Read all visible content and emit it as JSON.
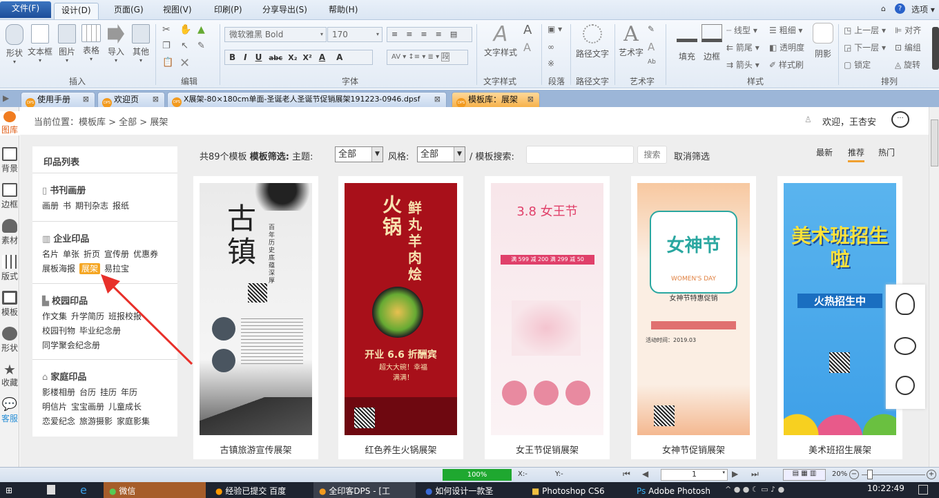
{
  "menu": {
    "items": [
      "文件(F)",
      "设计(D)",
      "页面(G)",
      "视图(V)",
      "印刷(P)",
      "分享导出(S)",
      "帮助(H)"
    ],
    "options": "选项"
  },
  "ribbon": {
    "insert": {
      "buttons": [
        "形状",
        "文本框",
        "图片",
        "表格",
        "导入",
        "其他"
      ],
      "label": "插入"
    },
    "edit": {
      "label": "编辑"
    },
    "font": {
      "name": "微软雅黑 Bold",
      "size": "170",
      "label": "字体",
      "bold": "B",
      "italic": "I",
      "underline": "U",
      "strike": "abc",
      "sub": "X₂",
      "sup": "X²",
      "color": "A",
      "highlight": "A",
      "spacing": "AV",
      "para": "段"
    },
    "textstyle": {
      "button": "文字样式",
      "label": "文字样式"
    },
    "paragraph": {
      "label": "段落"
    },
    "pathtext": {
      "button": "路径文字",
      "label": "路径文字"
    },
    "art": {
      "button": "艺术字",
      "label": "艺术字"
    },
    "style": {
      "fill": "填充",
      "border": "边框",
      "linetype": "线型",
      "weight": "粗细",
      "arrowtail": "箭尾",
      "opacity": "透明度",
      "arrowhead": "箭头",
      "brush": "样式刷",
      "shadow": "阴影",
      "label": "样式"
    },
    "arrange": {
      "up": "上一层",
      "align": "对齐",
      "down": "下一层",
      "group": "编组",
      "lock": "锁定",
      "rotate": "旋转",
      "label": "排列"
    }
  },
  "tabs": [
    {
      "label": "使用手册"
    },
    {
      "label": "欢迎页"
    },
    {
      "label": "X展架-80×180cm单面-圣诞老人圣诞节促销展架191223-0946.dpsf"
    },
    {
      "label": "模板库：展架"
    }
  ],
  "leftbar": [
    "图库",
    "背景",
    "边框",
    "素材",
    "版式",
    "模板",
    "形状",
    "收藏",
    "客服"
  ],
  "breadcrumb": "当前位置：模板库 > 全部 > 展架",
  "user": {
    "welcome": "欢迎，王杏安"
  },
  "sidebar": {
    "title": "印品列表",
    "sections": [
      {
        "title": "书刊画册",
        "links": [
          "画册",
          "书",
          "期刊杂志",
          "报纸"
        ]
      },
      {
        "title": "企业印品",
        "links": [
          "名片",
          "单张",
          "折页",
          "宣传册",
          "优惠券",
          "展板海报",
          "展架",
          "易拉宝"
        ],
        "selected": "展架"
      },
      {
        "title": "校园印品",
        "links": [
          "作文集",
          "升学简历",
          "班报校报",
          "校园刊物",
          "毕业纪念册",
          "同学聚会纪念册"
        ]
      },
      {
        "title": "家庭印品",
        "links": [
          "影楼相册",
          "台历",
          "挂历",
          "年历",
          "明信片",
          "宝宝画册",
          "儿童成长",
          "恋爱纪念",
          "旅游摄影",
          "家庭影集"
        ]
      }
    ]
  },
  "filter": {
    "count": "共89个模板",
    "filter_label": "模板筛选:",
    "theme_label": "主题:",
    "theme_value": "全部",
    "style_label": "风格:",
    "style_value": "全部",
    "search_label": "/ 模板搜索:",
    "search_value": "",
    "search_button": "搜索",
    "clear": "取消筛选"
  },
  "sort": {
    "items": [
      "最新",
      "推荐",
      "热门"
    ],
    "active": "推荐"
  },
  "templates": [
    {
      "title": "古镇旅游宣传展架",
      "headline": "古镇",
      "sub": "百年历史 底蕴深厚",
      "colors": [
        "#f1f1f1",
        "#222222"
      ]
    },
    {
      "title": "红色养生火锅展架",
      "headline": "火锅",
      "sub": "鲜丸羊肉烩",
      "promo": "开业 6.6 折酬宾",
      "promo2": "超大大碗！幸福满满！",
      "colors": [
        "#a8101a",
        "#f7e3b0"
      ]
    },
    {
      "title": "女王节促销展架",
      "headline": "3.8 女王节",
      "sub": "满 599 减 200 满 299 减 50",
      "colors": [
        "#f8e6ea",
        "#e0406a"
      ]
    },
    {
      "title": "女神节促销展架",
      "headline": "女神节",
      "sub": "WOMEN'S DAY",
      "promo": "女神节特惠促销",
      "promo2": "活动时间：2019.03",
      "colors": [
        "#fbeee3",
        "#2aa7a0"
      ]
    },
    {
      "title": "美术班招生展架",
      "headline": "美术班招生啦",
      "sub": "火热招生中",
      "colors": [
        "#3ea0e8",
        "#ffe23a"
      ]
    }
  ],
  "statusbar": {
    "progress": "100%",
    "progress_value": 100,
    "x": "X:-",
    "y": "Y:-",
    "page": "1",
    "zoom": "20%",
    "zoom_fraction": 0.2
  },
  "taskbar": {
    "items": [
      "微信",
      "经验已提交 百度",
      "全印客DPS - [工",
      "如何设计一款圣",
      "Photoshop CS6",
      "Adobe Photosh"
    ],
    "time": "10:22:49"
  }
}
